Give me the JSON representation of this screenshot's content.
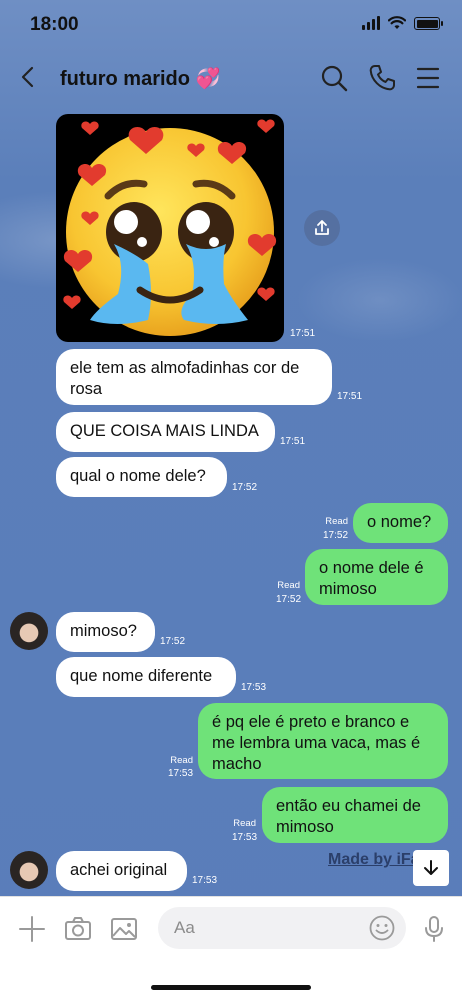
{
  "status_bar": {
    "time": "18:00"
  },
  "header": {
    "title": "futuro marido 💞",
    "icons": [
      "back-chevron-icon",
      "search-icon",
      "phone-icon",
      "menu-icon"
    ]
  },
  "messages": [
    {
      "side": "in",
      "type": "image",
      "time": "17:51",
      "image": "pleading-face-emoji-with-hearts"
    },
    {
      "side": "in",
      "text_line1": "ele tem as almofadinhas cor de",
      "text_line2": "rosa",
      "time": "17:51"
    },
    {
      "side": "in",
      "text": "QUE COISA MAIS LINDA",
      "time": "17:51"
    },
    {
      "side": "in",
      "text": "qual o nome dele?",
      "time": "17:52"
    },
    {
      "side": "out",
      "text": "o nome?",
      "read": "Read",
      "time": "17:52"
    },
    {
      "side": "out",
      "text_line1": "o nome dele é",
      "text_line2": "mimoso",
      "read": "Read",
      "time": "17:52"
    },
    {
      "side": "in",
      "text": "mimoso?",
      "time": "17:52",
      "avatar": true
    },
    {
      "side": "in",
      "text": "que nome diferente",
      "time": "17:53"
    },
    {
      "side": "out",
      "text_line1": "é pq ele é preto e branco e",
      "text_line2": "me lembra uma vaca, mas é",
      "text_line3": "macho",
      "read": "Read",
      "time": "17:53"
    },
    {
      "side": "out",
      "text_line1": "então eu chamei de",
      "text_line2": "mimoso",
      "read": "Read",
      "time": "17:53"
    },
    {
      "side": "in",
      "text": "achei original",
      "time": "17:53",
      "avatar": true
    }
  ],
  "watermark": "Made by iFake",
  "input_bar": {
    "placeholder": "Aa",
    "icons": [
      "plus-icon",
      "camera-icon",
      "image-icon",
      "emoji-icon",
      "microphone-icon"
    ]
  },
  "colors": {
    "background": "#5a7dba",
    "incoming_bubble": "#ffffff",
    "outgoing_bubble": "#6fe279"
  }
}
